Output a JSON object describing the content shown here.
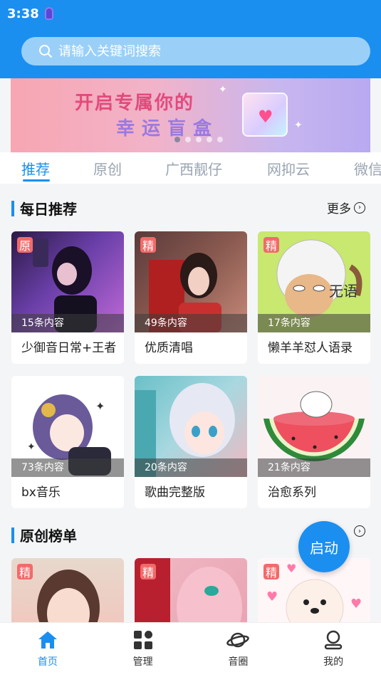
{
  "status_bar": {
    "time": "3:38"
  },
  "search": {
    "placeholder": "请输入关键词搜索"
  },
  "banner": {
    "line1": "开启专属你的",
    "line2": "幸运盲盒",
    "slide_count": 5,
    "active_slide": 0
  },
  "tabs": [
    "推荐",
    "原创",
    "广西靓仔",
    "网抑云",
    "微信"
  ],
  "active_tab": 0,
  "sections": [
    {
      "title": "每日推荐",
      "more_label": "更多",
      "cards": [
        {
          "badge": "原",
          "count": "15条内容",
          "name": "少御音日常+王者",
          "overlay": ""
        },
        {
          "badge": "精",
          "count": "49条内容",
          "name": "优质清唱",
          "overlay": ""
        },
        {
          "badge": "精",
          "count": "17条内容",
          "name": "懒羊羊怼人语录",
          "overlay": "无语"
        },
        {
          "badge": "",
          "count": "73条内容",
          "name": "bx音乐",
          "overlay": ""
        },
        {
          "badge": "",
          "count": "20条内容",
          "name": "歌曲完整版",
          "overlay": ""
        },
        {
          "badge": "",
          "count": "21条内容",
          "name": "治愈系列",
          "overlay": ""
        }
      ]
    },
    {
      "title": "原创榜单",
      "cards": [
        {
          "badge": "精"
        },
        {
          "badge": "精"
        },
        {
          "badge": "精"
        }
      ]
    }
  ],
  "fab": {
    "label": "启动"
  },
  "bottom_nav": [
    {
      "label": "首页",
      "icon": "home-icon",
      "active": true
    },
    {
      "label": "管理",
      "icon": "grid-icon",
      "active": false
    },
    {
      "label": "音圈",
      "icon": "planet-icon",
      "active": false
    },
    {
      "label": "我的",
      "icon": "user-icon",
      "active": false
    }
  ],
  "colors": {
    "primary": "#1a8ff0",
    "badge": "#f26a6a"
  }
}
